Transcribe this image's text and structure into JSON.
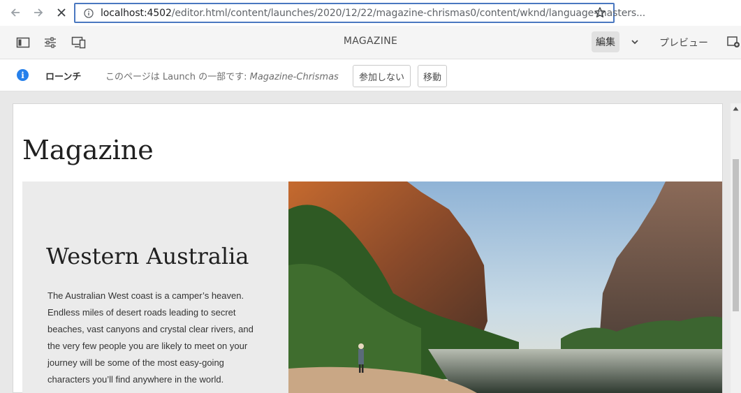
{
  "browser": {
    "url_host": "localhost:4502",
    "url_path": "/editor.html/content/launches/2020/12/22/magazine-chrismas0/content/wknd/language-masters..."
  },
  "toolbar": {
    "page_title": "MAGAZINE",
    "edit_label": "編集",
    "preview_label": "プレビュー",
    "icons": [
      "side-panel-icon",
      "page-properties-icon",
      "emulator-icon",
      "chevron-down-icon",
      "annotate-icon"
    ]
  },
  "launch": {
    "title": "ローンチ",
    "message_prefix": "このページは Launch の一部です:",
    "launch_name": "Magazine-Chrismas",
    "exclude_button": "参加しない",
    "move_button": "移動"
  },
  "page": {
    "heading": "Magazine",
    "hero": {
      "title": "Western Australia",
      "body": "The Australian West coast is a camper’s heaven. Endless miles of desert roads leading to secret beaches, vast canyons and crystal clear rivers, and the very few people you are likely to meet on your journey will be some of the most easy-going characters you’ll find anywhere in the world."
    }
  },
  "colors": {
    "accent_info": "#2680eb",
    "url_highlight": "#4a78c0",
    "toolbar_bg": "#f5f5f5"
  }
}
